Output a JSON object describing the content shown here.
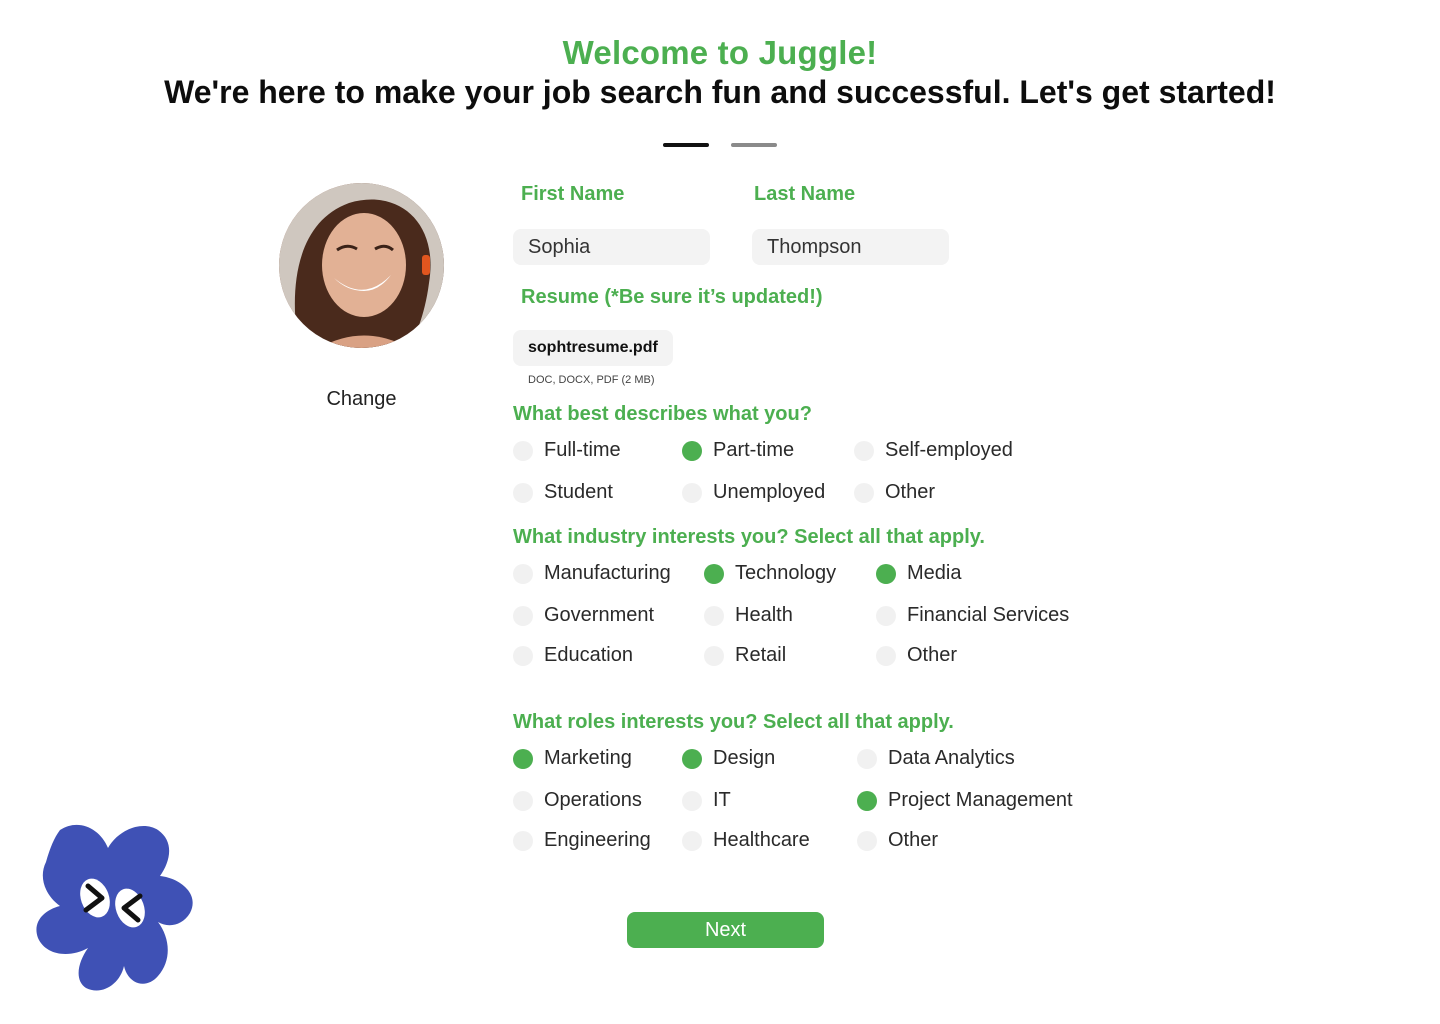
{
  "header": {
    "welcome": "Welcome to Juggle!",
    "tagline": "We're here to make your job search fun and successful. Let's get started!"
  },
  "progress": {
    "current_step": 1,
    "total_steps": 2
  },
  "profile": {
    "change_label": "Change"
  },
  "form": {
    "first_name": {
      "label": "First Name",
      "value": "Sophia"
    },
    "last_name": {
      "label": "Last Name",
      "value": "Thompson"
    },
    "resume": {
      "label": "Resume (*Be sure it’s updated!)",
      "file_name": "sophtresume.pdf",
      "hint": "DOC, DOCX, PDF (2 MB)"
    }
  },
  "employment": {
    "question": "What best describes what you?",
    "options": [
      {
        "label": "Full-time",
        "selected": false
      },
      {
        "label": "Part-time",
        "selected": true
      },
      {
        "label": "Self-employed",
        "selected": false
      },
      {
        "label": "Student",
        "selected": false
      },
      {
        "label": "Unemployed",
        "selected": false
      },
      {
        "label": "Other",
        "selected": false
      }
    ]
  },
  "industry": {
    "question": "What industry interests you? Select all that apply.",
    "options": [
      {
        "label": "Manufacturing",
        "selected": false
      },
      {
        "label": "Technology",
        "selected": true
      },
      {
        "label": "Media",
        "selected": true
      },
      {
        "label": "Government",
        "selected": false
      },
      {
        "label": "Health",
        "selected": false
      },
      {
        "label": "Financial Services",
        "selected": false
      },
      {
        "label": "Education",
        "selected": false
      },
      {
        "label": "Retail",
        "selected": false
      },
      {
        "label": "Other",
        "selected": false
      }
    ]
  },
  "roles": {
    "question": "What roles interests you? Select all that apply.",
    "options": [
      {
        "label": "Marketing",
        "selected": true
      },
      {
        "label": "Design",
        "selected": true
      },
      {
        "label": "Data Analytics",
        "selected": false
      },
      {
        "label": "Operations",
        "selected": false
      },
      {
        "label": "IT",
        "selected": false
      },
      {
        "label": "Project Management",
        "selected": true
      },
      {
        "label": "Engineering",
        "selected": false
      },
      {
        "label": "Healthcare",
        "selected": false
      },
      {
        "label": "Other",
        "selected": false
      }
    ]
  },
  "actions": {
    "next_label": "Next"
  },
  "colors": {
    "accent": "#4caf50",
    "mascot": "#3f51b5",
    "field_bg": "#f3f3f3",
    "unselected": "#f1f1f1"
  }
}
